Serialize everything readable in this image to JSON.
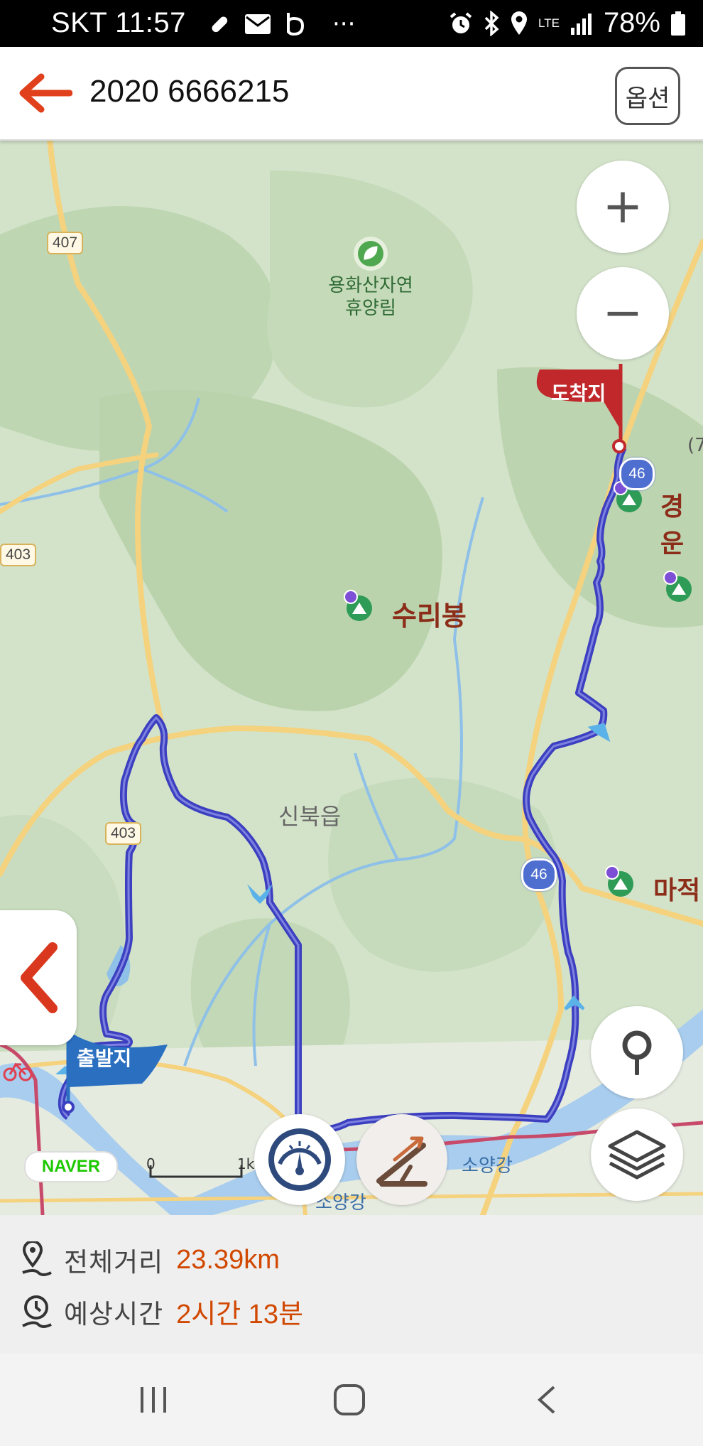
{
  "status_bar": {
    "carrier_time": "SKT 11:57",
    "overflow": "···",
    "network": "LTE",
    "battery": "78%",
    "icons_left": [
      "pill-icon",
      "mail-icon",
      "b-app-icon"
    ],
    "icons_right": [
      "alarm-icon",
      "bluetooth-icon",
      "location-icon",
      "signal-icon",
      "battery-icon"
    ]
  },
  "header": {
    "title": "2020 6666215",
    "options_label": "옵션",
    "accent": "#e0401b"
  },
  "map": {
    "labels": {
      "forest_line1": "용화산자연",
      "forest_line2": "휴양림",
      "peak_suri": "수리봉",
      "town": "신북읍",
      "peak_right1": "경운",
      "peak_right2": "마적",
      "river1": "소양강",
      "river2": "소양강",
      "edge_paren": "(7"
    },
    "road_badges": {
      "r407": "407",
      "r403": "403",
      "r403b": "403"
    },
    "highway_badges": {
      "h46a": "46",
      "h46b": "46"
    },
    "flags": {
      "finish": "도착지",
      "start": "출발지"
    },
    "scale": {
      "zero": "0",
      "unit": "1k"
    },
    "naver_logo": "NAVER",
    "route_color": "#3b3fc0",
    "finish_color": "#c0282c",
    "start_color": "#2a6fc0"
  },
  "controls": {
    "zoom_in": "+",
    "zoom_out": "−",
    "buttons": [
      "zoom-in-button",
      "zoom-out-button",
      "my-location-button",
      "layers-button",
      "speedometer-button",
      "elevation-button",
      "collapse-panel-button"
    ]
  },
  "summary": {
    "distance_label": "전체거리",
    "distance_value": "23.39km",
    "time_label": "예상시간",
    "time_value": "2시간 13분",
    "value_color": "#d14800"
  }
}
